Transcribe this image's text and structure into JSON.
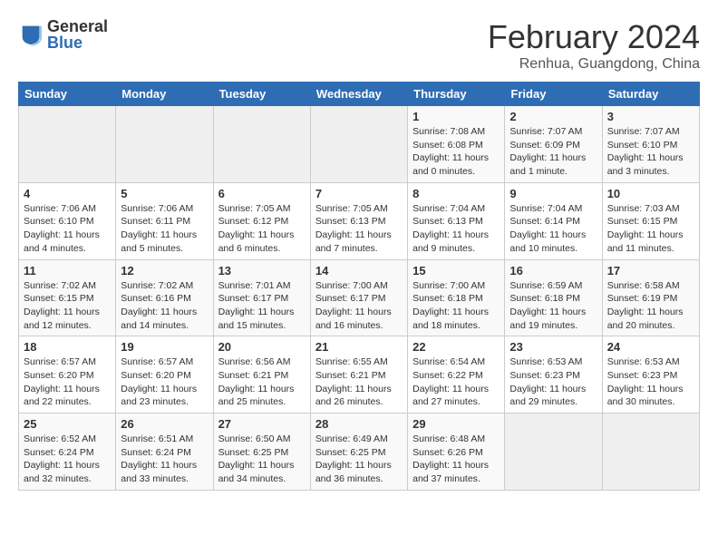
{
  "header": {
    "logo": {
      "general": "General",
      "blue": "Blue"
    },
    "title": "February 2024",
    "subtitle": "Renhua, Guangdong, China"
  },
  "calendar": {
    "days_of_week": [
      "Sunday",
      "Monday",
      "Tuesday",
      "Wednesday",
      "Thursday",
      "Friday",
      "Saturday"
    ],
    "weeks": [
      [
        {
          "num": "",
          "info": ""
        },
        {
          "num": "",
          "info": ""
        },
        {
          "num": "",
          "info": ""
        },
        {
          "num": "",
          "info": ""
        },
        {
          "num": "1",
          "info": "Sunrise: 7:08 AM\nSunset: 6:08 PM\nDaylight: 11 hours and 0 minutes."
        },
        {
          "num": "2",
          "info": "Sunrise: 7:07 AM\nSunset: 6:09 PM\nDaylight: 11 hours and 1 minute."
        },
        {
          "num": "3",
          "info": "Sunrise: 7:07 AM\nSunset: 6:10 PM\nDaylight: 11 hours and 3 minutes."
        }
      ],
      [
        {
          "num": "4",
          "info": "Sunrise: 7:06 AM\nSunset: 6:10 PM\nDaylight: 11 hours and 4 minutes."
        },
        {
          "num": "5",
          "info": "Sunrise: 7:06 AM\nSunset: 6:11 PM\nDaylight: 11 hours and 5 minutes."
        },
        {
          "num": "6",
          "info": "Sunrise: 7:05 AM\nSunset: 6:12 PM\nDaylight: 11 hours and 6 minutes."
        },
        {
          "num": "7",
          "info": "Sunrise: 7:05 AM\nSunset: 6:13 PM\nDaylight: 11 hours and 7 minutes."
        },
        {
          "num": "8",
          "info": "Sunrise: 7:04 AM\nSunset: 6:13 PM\nDaylight: 11 hours and 9 minutes."
        },
        {
          "num": "9",
          "info": "Sunrise: 7:04 AM\nSunset: 6:14 PM\nDaylight: 11 hours and 10 minutes."
        },
        {
          "num": "10",
          "info": "Sunrise: 7:03 AM\nSunset: 6:15 PM\nDaylight: 11 hours and 11 minutes."
        }
      ],
      [
        {
          "num": "11",
          "info": "Sunrise: 7:02 AM\nSunset: 6:15 PM\nDaylight: 11 hours and 12 minutes."
        },
        {
          "num": "12",
          "info": "Sunrise: 7:02 AM\nSunset: 6:16 PM\nDaylight: 11 hours and 14 minutes."
        },
        {
          "num": "13",
          "info": "Sunrise: 7:01 AM\nSunset: 6:17 PM\nDaylight: 11 hours and 15 minutes."
        },
        {
          "num": "14",
          "info": "Sunrise: 7:00 AM\nSunset: 6:17 PM\nDaylight: 11 hours and 16 minutes."
        },
        {
          "num": "15",
          "info": "Sunrise: 7:00 AM\nSunset: 6:18 PM\nDaylight: 11 hours and 18 minutes."
        },
        {
          "num": "16",
          "info": "Sunrise: 6:59 AM\nSunset: 6:18 PM\nDaylight: 11 hours and 19 minutes."
        },
        {
          "num": "17",
          "info": "Sunrise: 6:58 AM\nSunset: 6:19 PM\nDaylight: 11 hours and 20 minutes."
        }
      ],
      [
        {
          "num": "18",
          "info": "Sunrise: 6:57 AM\nSunset: 6:20 PM\nDaylight: 11 hours and 22 minutes."
        },
        {
          "num": "19",
          "info": "Sunrise: 6:57 AM\nSunset: 6:20 PM\nDaylight: 11 hours and 23 minutes."
        },
        {
          "num": "20",
          "info": "Sunrise: 6:56 AM\nSunset: 6:21 PM\nDaylight: 11 hours and 25 minutes."
        },
        {
          "num": "21",
          "info": "Sunrise: 6:55 AM\nSunset: 6:21 PM\nDaylight: 11 hours and 26 minutes."
        },
        {
          "num": "22",
          "info": "Sunrise: 6:54 AM\nSunset: 6:22 PM\nDaylight: 11 hours and 27 minutes."
        },
        {
          "num": "23",
          "info": "Sunrise: 6:53 AM\nSunset: 6:23 PM\nDaylight: 11 hours and 29 minutes."
        },
        {
          "num": "24",
          "info": "Sunrise: 6:53 AM\nSunset: 6:23 PM\nDaylight: 11 hours and 30 minutes."
        }
      ],
      [
        {
          "num": "25",
          "info": "Sunrise: 6:52 AM\nSunset: 6:24 PM\nDaylight: 11 hours and 32 minutes."
        },
        {
          "num": "26",
          "info": "Sunrise: 6:51 AM\nSunset: 6:24 PM\nDaylight: 11 hours and 33 minutes."
        },
        {
          "num": "27",
          "info": "Sunrise: 6:50 AM\nSunset: 6:25 PM\nDaylight: 11 hours and 34 minutes."
        },
        {
          "num": "28",
          "info": "Sunrise: 6:49 AM\nSunset: 6:25 PM\nDaylight: 11 hours and 36 minutes."
        },
        {
          "num": "29",
          "info": "Sunrise: 6:48 AM\nSunset: 6:26 PM\nDaylight: 11 hours and 37 minutes."
        },
        {
          "num": "",
          "info": ""
        },
        {
          "num": "",
          "info": ""
        }
      ]
    ]
  }
}
